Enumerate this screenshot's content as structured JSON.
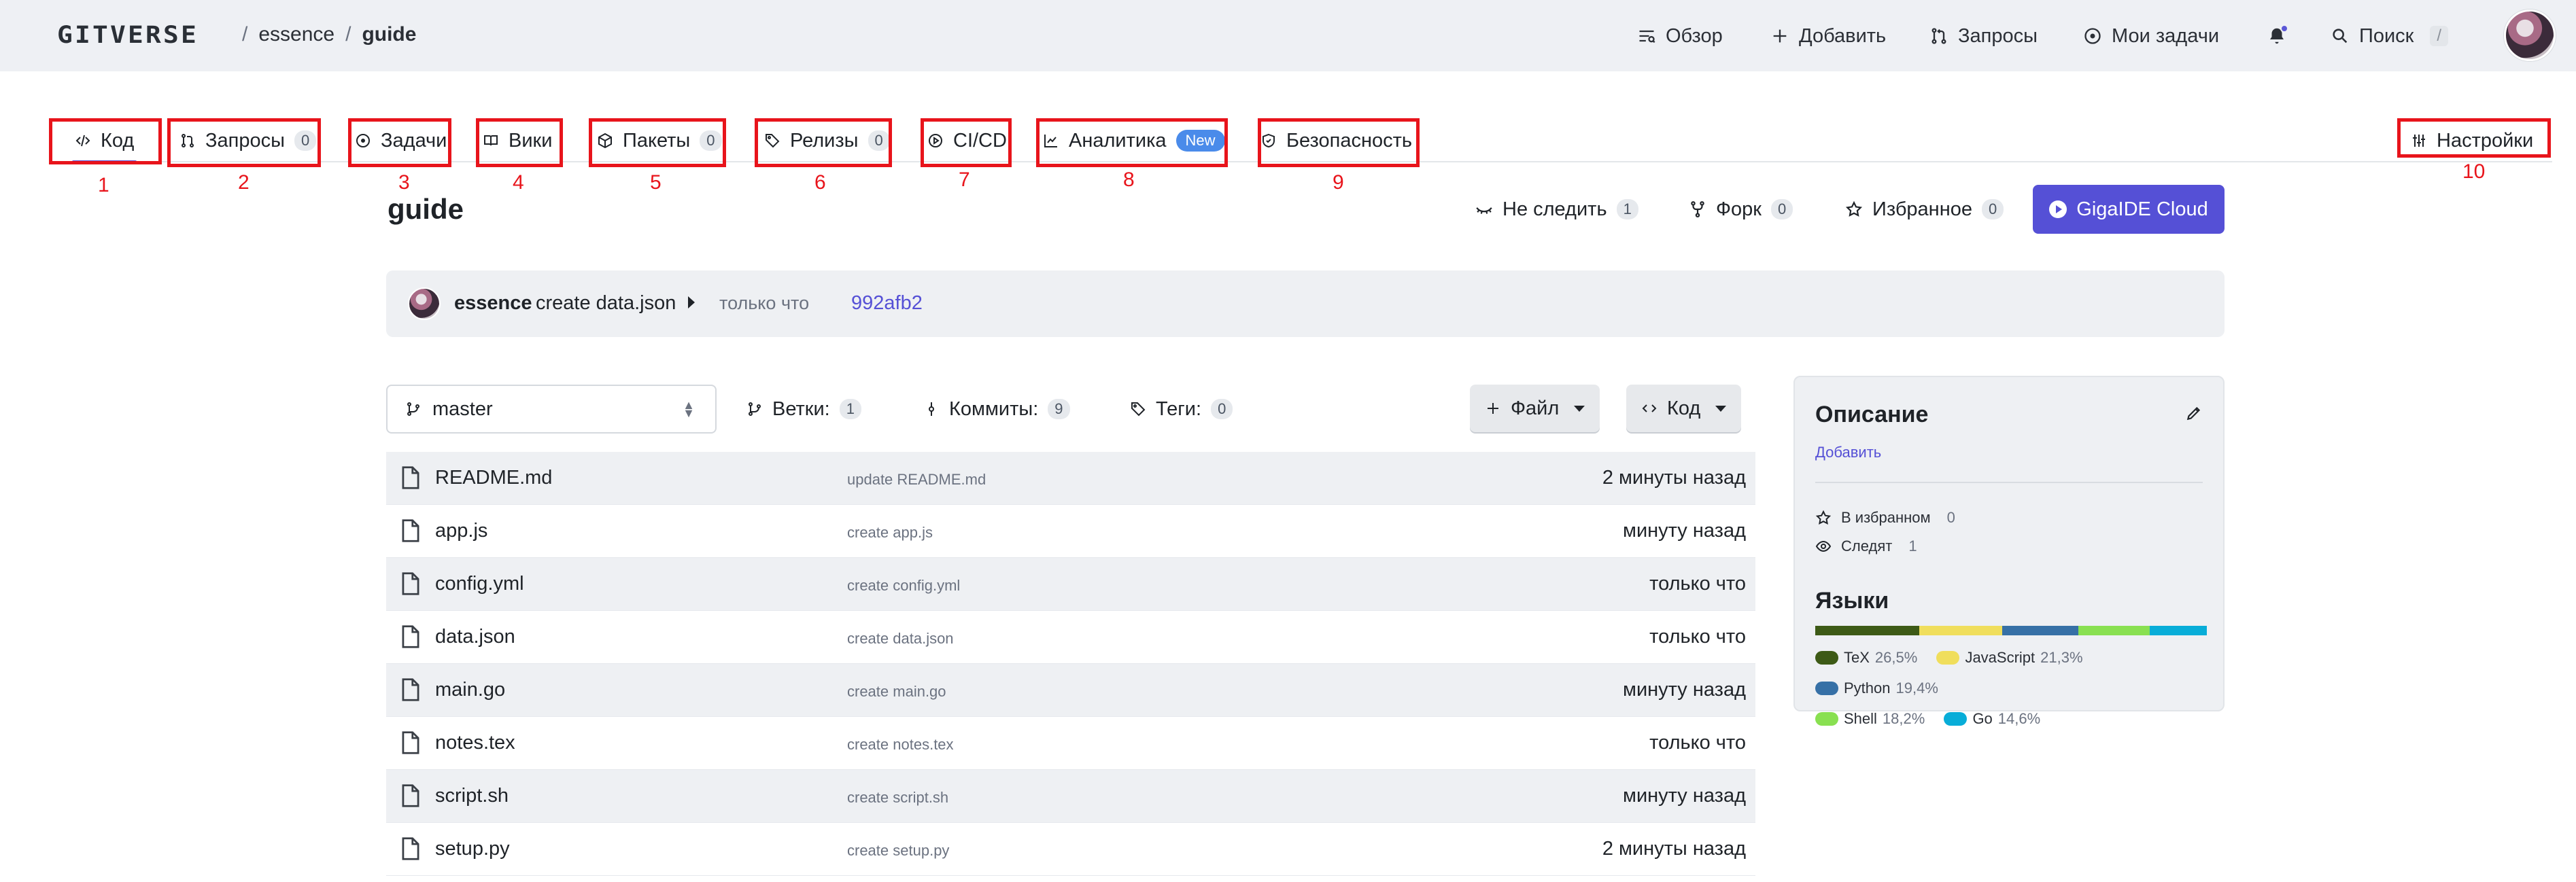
{
  "header": {
    "logo": "GITVERSE",
    "crumbs": {
      "owner": "essence",
      "sep": "/",
      "repo": "guide"
    },
    "nav": {
      "overview": "Обзор",
      "add": "Добавить",
      "requests": "Запросы",
      "my_tasks": "Мои задачи",
      "search": "Поиск",
      "search_kbd": "/"
    }
  },
  "tabs": {
    "code": "Код",
    "requests": "Запросы",
    "requests_count": "0",
    "tasks": "Задачи",
    "wiki": "Вики",
    "packages": "Пакеты",
    "packages_count": "0",
    "releases": "Релизы",
    "releases_count": "0",
    "cicd": "CI/CD",
    "analytics": "Аналитика",
    "analytics_badge": "New",
    "security": "Безопасность",
    "settings": "Настройки"
  },
  "annotations": [
    "1",
    "2",
    "3",
    "4",
    "5",
    "6",
    "7",
    "8",
    "9",
    "10"
  ],
  "repo": {
    "title": "guide",
    "watch": "Не следить",
    "watch_count": "1",
    "fork": "Форк",
    "fork_count": "0",
    "star": "Избранное",
    "star_count": "0",
    "ide": "GigaIDE Cloud"
  },
  "commit": {
    "author": "essence",
    "message": "create data.json",
    "time": "только что",
    "sha": "992afb2"
  },
  "toolbar": {
    "branch": "master",
    "branches": "Ветки:",
    "branches_count": "1",
    "commits": "Коммиты:",
    "commits_count": "9",
    "tags": "Теги:",
    "tags_count": "0",
    "file_btn": "Файл",
    "code_btn": "Код"
  },
  "files": [
    {
      "name": "README.md",
      "msg": "update README.md",
      "time": "2 минуты назад"
    },
    {
      "name": "app.js",
      "msg": "create app.js",
      "time": "минуту назад"
    },
    {
      "name": "config.yml",
      "msg": "create config.yml",
      "time": "только что"
    },
    {
      "name": "data.json",
      "msg": "create data.json",
      "time": "только что"
    },
    {
      "name": "main.go",
      "msg": "create main.go",
      "time": "минуту назад"
    },
    {
      "name": "notes.tex",
      "msg": "create notes.tex",
      "time": "только что"
    },
    {
      "name": "script.sh",
      "msg": "create script.sh",
      "time": "минуту назад"
    },
    {
      "name": "setup.py",
      "msg": "create setup.py",
      "time": "2 минуты назад"
    }
  ],
  "sidebar": {
    "title": "Описание",
    "add": "Добавить",
    "favorites": "В избранном",
    "favorites_count": "0",
    "watchers": "Следят",
    "watchers_count": "1",
    "langs_title": "Языки",
    "languages": [
      {
        "name": "TeX",
        "pct": "26,5%",
        "share": 26.5,
        "color": "#3d5a16"
      },
      {
        "name": "JavaScript",
        "pct": "21,3%",
        "share": 21.3,
        "color": "#f0de5c"
      },
      {
        "name": "Python",
        "pct": "19,4%",
        "share": 19.4,
        "color": "#3670a6"
      },
      {
        "name": "Shell",
        "pct": "18,2%",
        "share": 18.2,
        "color": "#89e051"
      },
      {
        "name": "Go",
        "pct": "14,6%",
        "share": 14.6,
        "color": "#08add8"
      }
    ]
  },
  "colors": {
    "accent": "#5550d6",
    "annotation": "#e8141b",
    "badge_new": "#4a8bea"
  }
}
